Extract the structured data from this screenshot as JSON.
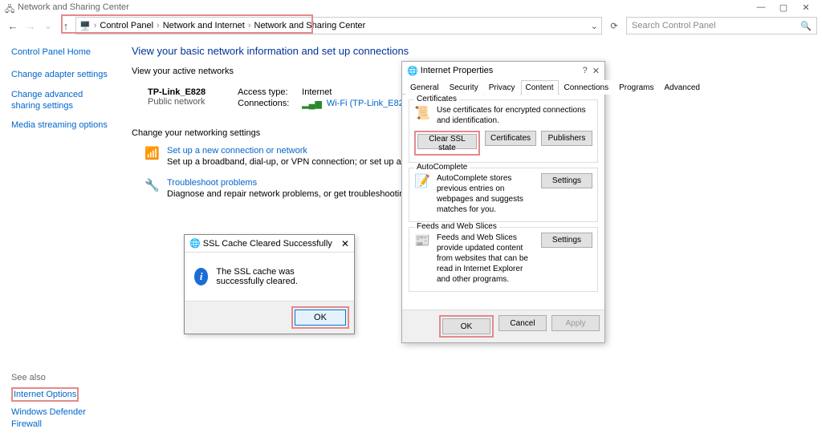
{
  "window": {
    "title": "Network and Sharing Center"
  },
  "breadcrumb": {
    "items": [
      "Control Panel",
      "Network and Internet",
      "Network and Sharing Center"
    ]
  },
  "search": {
    "placeholder": "Search Control Panel"
  },
  "sidebar": {
    "home": "Control Panel Home",
    "links": [
      "Change adapter settings",
      "Change advanced sharing settings",
      "Media streaming options"
    ],
    "see_also_label": "See also",
    "see_also": [
      "Internet Options",
      "Windows Defender Firewall"
    ]
  },
  "content": {
    "heading": "View your basic network information and set up connections",
    "active_label": "View your active networks",
    "network": {
      "name": "TP-Link_E828",
      "type": "Public network",
      "access_label": "Access type:",
      "access_value": "Internet",
      "conn_label": "Connections:",
      "conn_value": "Wi-Fi (TP-Link_E828)"
    },
    "change_label": "Change your networking settings",
    "actions": [
      {
        "title": "Set up a new connection or network",
        "desc": "Set up a broadband, dial-up, or VPN connection; or set up a router or access point."
      },
      {
        "title": "Troubleshoot problems",
        "desc": "Diagnose and repair network problems, or get troubleshooting information."
      }
    ]
  },
  "ssl_dialog": {
    "title": "SSL Cache Cleared Successfully",
    "message": "The SSL cache was successfully cleared.",
    "ok": "OK"
  },
  "inet_dialog": {
    "title": "Internet Properties",
    "tabs": [
      "General",
      "Security",
      "Privacy",
      "Content",
      "Connections",
      "Programs",
      "Advanced"
    ],
    "active_tab": "Content",
    "certificates": {
      "legend": "Certificates",
      "text": "Use certificates for encrypted connections and identification.",
      "btn_clear": "Clear SSL state",
      "btn_cert": "Certificates",
      "btn_pub": "Publishers"
    },
    "autocomplete": {
      "legend": "AutoComplete",
      "text": "AutoComplete stores previous entries on webpages and suggests matches for you.",
      "btn": "Settings"
    },
    "feeds": {
      "legend": "Feeds and Web Slices",
      "text": "Feeds and Web Slices provide updated content from websites that can be read in Internet Explorer and other programs.",
      "btn": "Settings"
    },
    "footer": {
      "ok": "OK",
      "cancel": "Cancel",
      "apply": "Apply"
    }
  }
}
